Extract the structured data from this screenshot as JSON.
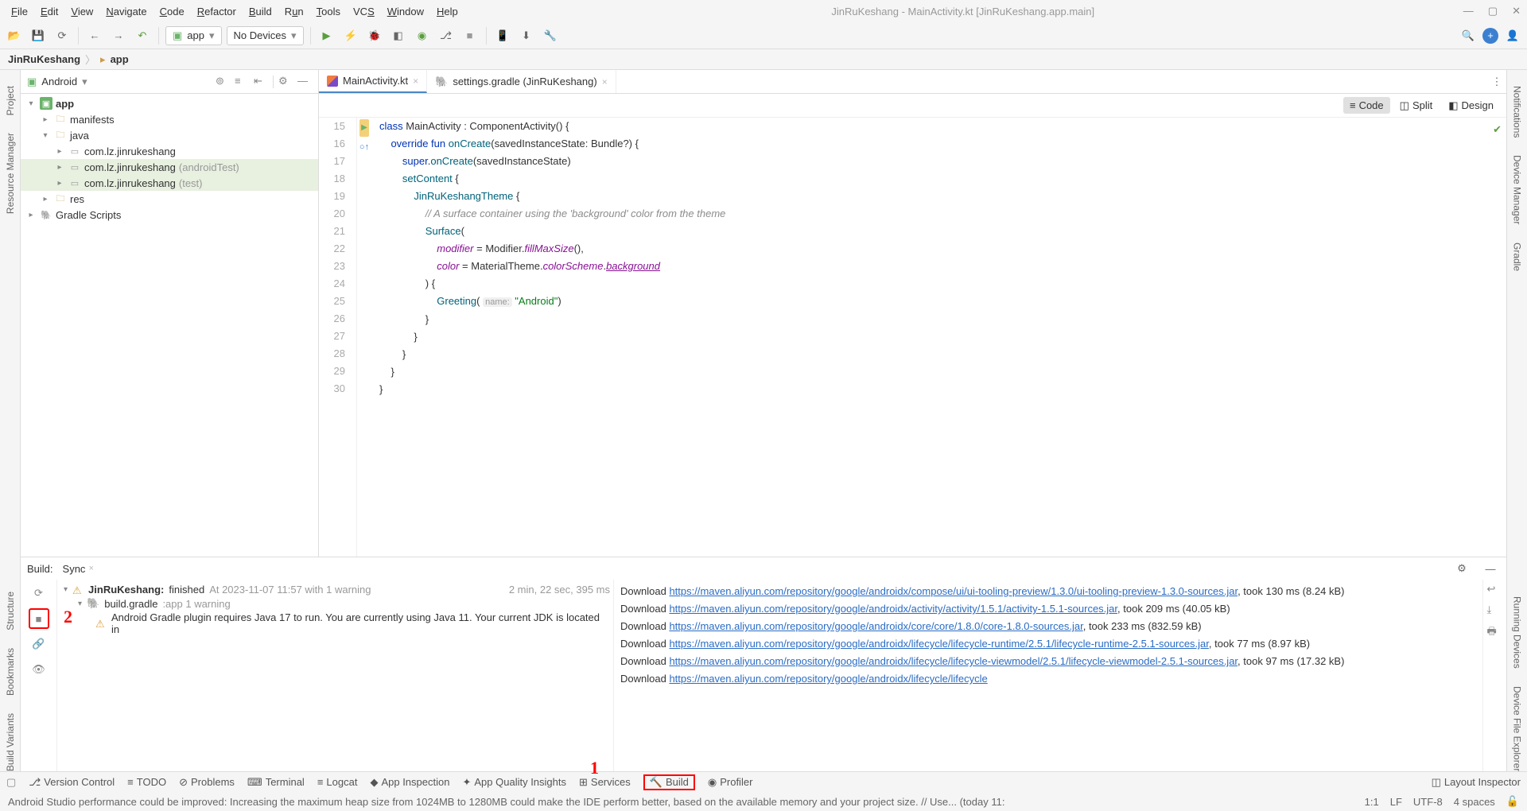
{
  "window": {
    "title": "JinRuKeshang - MainActivity.kt [JinRuKeshang.app.main]"
  },
  "menu": [
    "File",
    "Edit",
    "View",
    "Navigate",
    "Code",
    "Refactor",
    "Build",
    "Run",
    "Tools",
    "VCS",
    "Window",
    "Help"
  ],
  "toolbar": {
    "config": "app",
    "device": "No Devices"
  },
  "breadcrumb": {
    "root": "JinRuKeshang",
    "leaf": "app"
  },
  "project": {
    "viewer": "Android",
    "nodes": {
      "app": "app",
      "manifests": "manifests",
      "java": "java",
      "p1": "com.lz.jinrukeshang",
      "p2": "com.lz.jinrukeshang",
      "p2q": "(androidTest)",
      "p3": "com.lz.jinrukeshang",
      "p3q": "(test)",
      "res": "res",
      "gradle": "Gradle Scripts"
    }
  },
  "tabs": {
    "t1": "MainActivity.kt",
    "t2": "settings.gradle (JinRuKeshang)"
  },
  "viewtabs": {
    "code": "Code",
    "split": "Split",
    "design": "Design"
  },
  "editor": {
    "startLine": 15,
    "lines": [
      "class MainActivity : ComponentActivity() {",
      "    override fun onCreate(savedInstanceState: Bundle?) {",
      "        super.onCreate(savedInstanceState)",
      "        setContent {",
      "            JinRuKeshangTheme {",
      "                // A surface container using the 'background' color from the theme",
      "                Surface(",
      "                    modifier = Modifier.fillMaxSize(),",
      "                    color = MaterialTheme.colorScheme.background",
      "                ) {",
      "                    Greeting( name: \"Android\")",
      "                }",
      "            }",
      "        }",
      "    }",
      "}"
    ]
  },
  "build": {
    "tab1": "Build:",
    "tab2": "Sync",
    "root": "JinRuKeshang:",
    "rootStatus": "finished",
    "rootTime": "At 2023-11-07 11:57 with 1 warning",
    "rootDur": "2 min, 22 sec, 395 ms",
    "gradle": "build.gradle",
    "gradleStatus": ":app 1 warning",
    "msg": "Android Gradle plugin requires Java 17 to run. You are currently using Java 11. Your current JDK is located in",
    "dl": [
      {
        "pre": "Download ",
        "url": "https://maven.aliyun.com/repository/google/androidx/compose/ui/ui-tooling-preview/1.3.0/ui-tooling-preview-1.3.0-sources.jar",
        "post": ", took 130 ms (8.24 kB)"
      },
      {
        "pre": "Download ",
        "url": "https://maven.aliyun.com/repository/google/androidx/activity/activity/1.5.1/activity-1.5.1-sources.jar",
        "post": ", took 209 ms (40.05 kB)"
      },
      {
        "pre": "Download ",
        "url": "https://maven.aliyun.com/repository/google/androidx/core/core/1.8.0/core-1.8.0-sources.jar",
        "post": ", took 233 ms (832.59 kB)"
      },
      {
        "pre": "Download ",
        "url": "https://maven.aliyun.com/repository/google/androidx/lifecycle/lifecycle-runtime/2.5.1/lifecycle-runtime-2.5.1-sources.jar",
        "post": ", took 77 ms (8.97 kB)"
      },
      {
        "pre": "Download ",
        "url": "https://maven.aliyun.com/repository/google/androidx/lifecycle/lifecycle-viewmodel/2.5.1/lifecycle-viewmodel-2.5.1-sources.jar",
        "post": ", took 97 ms (17.32 kB)"
      },
      {
        "pre": "Download ",
        "url": "https://maven.aliyun.com/repository/google/androidx/lifecycle/lifecycle",
        "post": ""
      }
    ]
  },
  "bottombar": {
    "items": [
      "Version Control",
      "TODO",
      "Problems",
      "Terminal",
      "Logcat",
      "App Inspection",
      "App Quality Insights",
      "Services",
      "Build",
      "Profiler"
    ],
    "right": "Layout Inspector"
  },
  "status": {
    "msg": "Android Studio performance could be improved: Increasing the maximum heap size from 1024MB to 1280MB could make the IDE perform better, based on the available memory and your project size. // Use... (today 11:",
    "pos": "1:1",
    "lf": "LF",
    "enc": "UTF-8",
    "indent": "4 spaces"
  },
  "leftpanel": [
    "Project",
    "Resource Manager"
  ],
  "leftpanel2": [
    "Structure",
    "Bookmarks",
    "Build Variants"
  ],
  "rightpanel": [
    "Notifications",
    "Device Manager",
    "Gradle"
  ],
  "rightpanel2": [
    "Running Devices",
    "Device File Explorer"
  ],
  "annotations": {
    "n1": "1",
    "n2": "2"
  }
}
